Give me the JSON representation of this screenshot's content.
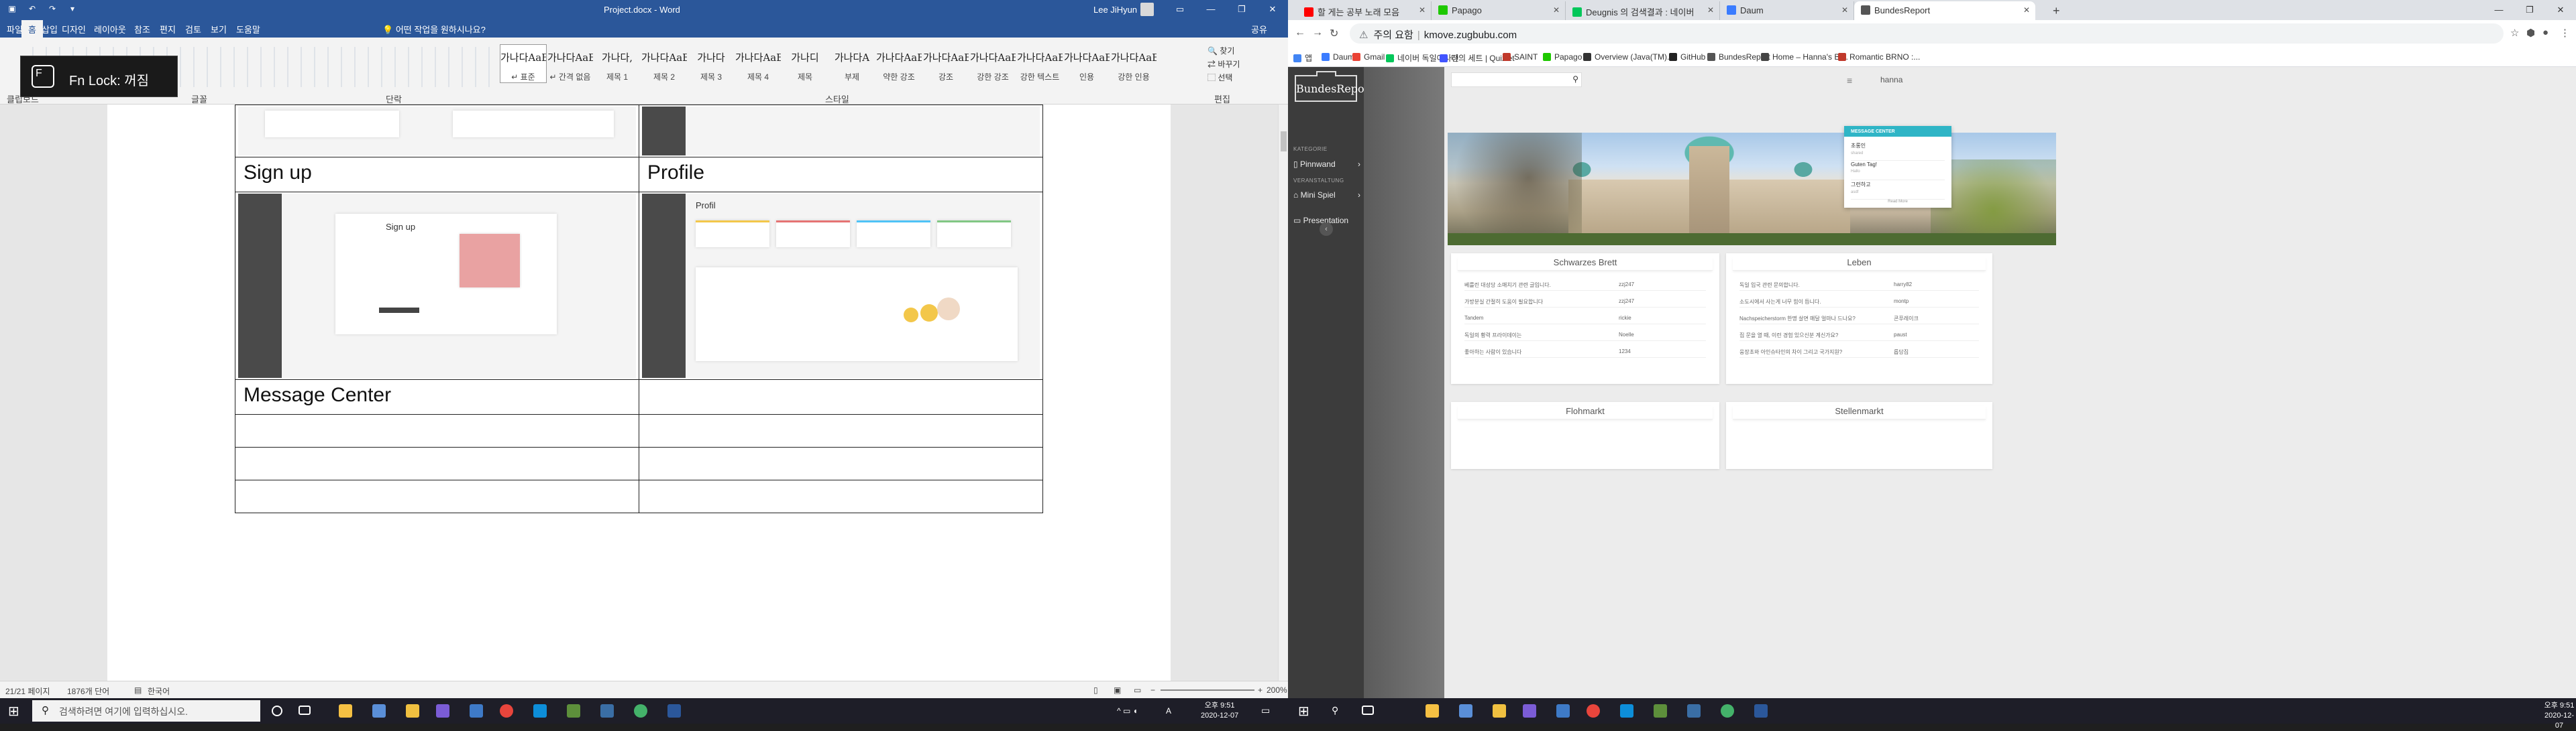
{
  "word": {
    "title_bar": {
      "doc_title": "Project.docx - Word",
      "user": "Lee JiHyun",
      "qat": [
        "save-icon",
        "undo-icon",
        "redo-icon",
        "customize-icon"
      ]
    },
    "tabs": [
      "파일",
      "홈",
      "삽입",
      "디자인",
      "레이아웃",
      "참조",
      "편지",
      "검토",
      "보기",
      "도움말"
    ],
    "active_tab": "홈",
    "tell_me": "어떤 작업을 원하시나요?",
    "share": "공유",
    "ribbon_groups": [
      "클립보드",
      "글꼴",
      "단락",
      "스타일",
      "편집"
    ],
    "styles": [
      {
        "preview": "가나다AaE",
        "name": "↵ 표준"
      },
      {
        "preview": "가나다AaE",
        "name": "↵ 간격 없음"
      },
      {
        "preview": "가나다,",
        "name": "제목 1"
      },
      {
        "preview": "가나다AaE",
        "name": "제목 2"
      },
      {
        "preview": "가나다",
        "name": "제목 3"
      },
      {
        "preview": "가나다AaE",
        "name": "제목 4"
      },
      {
        "preview": "가나디",
        "name": "제목"
      },
      {
        "preview": "가나다A",
        "name": "부제"
      },
      {
        "preview": "가나다AaE",
        "name": "약한 강조"
      },
      {
        "preview": "가나다AaE",
        "name": "강조"
      },
      {
        "preview": "가나다AaE",
        "name": "강한 강조"
      },
      {
        "preview": "가나다AaE",
        "name": "강한 텍스트"
      },
      {
        "preview": "가나다AaE",
        "name": "인용"
      },
      {
        "preview": "가나다AaE",
        "name": "강한 인용"
      }
    ],
    "editing": [
      "찾기",
      "바꾸기",
      "선택"
    ],
    "fn_lock": {
      "key": "F",
      "text": "Fn Lock: 꺼짐"
    },
    "doc_table": {
      "row1_headers": [
        "Sign up",
        "Profile"
      ],
      "row2_headers": [
        "Message Center",
        ""
      ],
      "signup_shot": {
        "title": "Sign up"
      },
      "profile_shot": {
        "title": "Profil"
      }
    },
    "status": {
      "page": "21/21 페이지",
      "words": "1876개 단어",
      "lang": "한국어",
      "zoom": "200%"
    }
  },
  "chrome": {
    "tabs": [
      {
        "title": "할 게는 공부 노래 모음",
        "color": "#ff0000"
      },
      {
        "title": "Papago",
        "color": "#1ec800"
      },
      {
        "title": "Deugnis 의 검색결과 : 네이버",
        "color": "#03c75a"
      },
      {
        "title": "Daum",
        "color": "#3b7cff"
      },
      {
        "title": "BundesReport",
        "color": "#555555"
      }
    ],
    "active_tab_index": 4,
    "new_tab": "+",
    "omnibox": {
      "warning": "주의 요함",
      "url": "kmove.zugbubu.com"
    },
    "bookmarks": [
      "앱",
      "Daum",
      "Gmail",
      "네이버 독일어사전",
      "나의 세트 | Quizlet",
      "SAINT",
      "Papago",
      "Overview (Java(TM)...",
      "GitHub",
      "BundesReport",
      "Home – Hanna's Bl...",
      "Romantic BRNO :..."
    ],
    "site": {
      "logo": "BundesReport",
      "sidebar": {
        "section1": "KATEGORIE",
        "item1": "Pinnwand",
        "section2": "VERANSTALTUNG",
        "item2": "Mini Spiel",
        "item3": "Presentation"
      },
      "user": "hanna",
      "message_center": {
        "header": "MESSAGE CENTER",
        "items": [
          {
            "title": "초롱인",
            "sub": "shared"
          },
          {
            "title": "Guten Tag!",
            "sub": "Hallo"
          },
          {
            "title": "그런하고",
            "sub": "asdf"
          }
        ],
        "more": "Read More"
      },
      "boards": [
        {
          "title": "Schwarzes Brett",
          "rows": [
            {
              "title": "베를린 대성당 소매치기 관련 글입니다.",
              "author": "zzj247"
            },
            {
              "title": "가방분실 간절히 도움이 필요합니다",
              "author": "zzj247"
            },
            {
              "title": "Tandem",
              "author": "rickie"
            },
            {
              "title": "독일의 황력 프라이데이는",
              "author": "Noelle"
            },
            {
              "title": "좋아하는 사람이 있습니다",
              "author": "1234"
            }
          ]
        },
        {
          "title": "Leben",
          "rows": [
            {
              "title": "독일 입국 관련 문의합니다.",
              "author": "harry82"
            },
            {
              "title": "소도시에서 사는게 너무 힘이 듭니다.",
              "author": "montp"
            },
            {
              "title": "Nachspeicherstorm 한명 살면 매달 얼마나 드나요?",
              "author": "콘푸레이크"
            },
            {
              "title": "집 문을 열 때, 이런 경험 있으신분 계신가요?",
              "author": "paust"
            },
            {
              "title": "웅장초와 아인슈타인의 차이 그리고 국가지원?",
              "author": "롭담집"
            }
          ]
        },
        {
          "title": "Flohmarkt",
          "rows": []
        },
        {
          "title": "Stellenmarkt",
          "rows": []
        }
      ]
    }
  },
  "taskbar": {
    "search_placeholder": "검색하려면 여기에 입력하십시오.",
    "clock_left": {
      "time": "오후 9:51",
      "date": "2020-12-07"
    },
    "clock_right": {
      "time": "오후 9:51",
      "date": "2020-12-07"
    },
    "ime": "A"
  },
  "colors": {
    "word_blue": "#2b579a",
    "chrome_tabstrip": "#dee1e6",
    "site_sidebar": "#3c3c3c",
    "message_center": "#2fb5c6"
  }
}
